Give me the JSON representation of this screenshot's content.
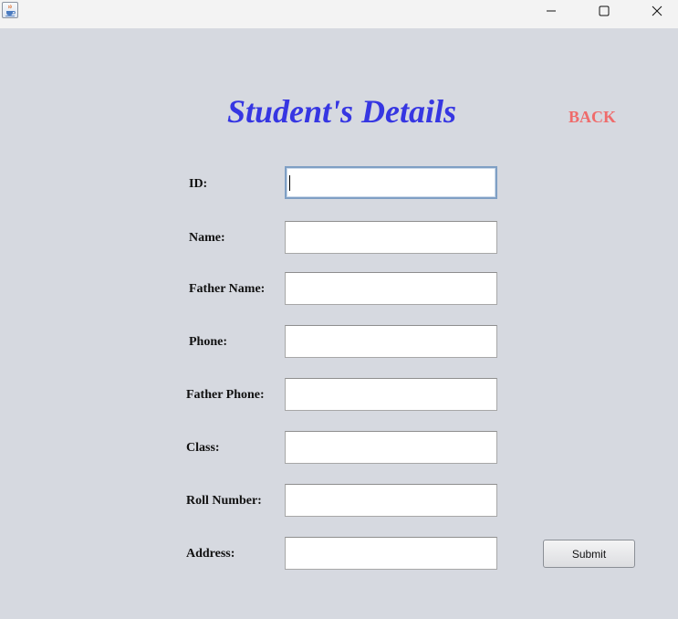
{
  "window": {
    "icon": "java-cup-icon",
    "controls": {
      "minimize": "minimize-icon",
      "maximize": "maximize-icon",
      "close": "close-icon"
    }
  },
  "form": {
    "title": "Student's Details",
    "back_label": "BACK",
    "submit_label": "Submit",
    "fields": [
      {
        "label": "ID:",
        "value": ""
      },
      {
        "label": "Name:",
        "value": ""
      },
      {
        "label": "Father Name:",
        "value": ""
      },
      {
        "label": "Phone:",
        "value": ""
      },
      {
        "label": "Father Phone:",
        "value": ""
      },
      {
        "label": "Class:",
        "value": ""
      },
      {
        "label": "Roll Number:",
        "value": ""
      },
      {
        "label": "Address:",
        "value": ""
      }
    ]
  },
  "colors": {
    "title": "#3636e2",
    "back": "#ef6b6b",
    "background": "#d6d9e0"
  }
}
